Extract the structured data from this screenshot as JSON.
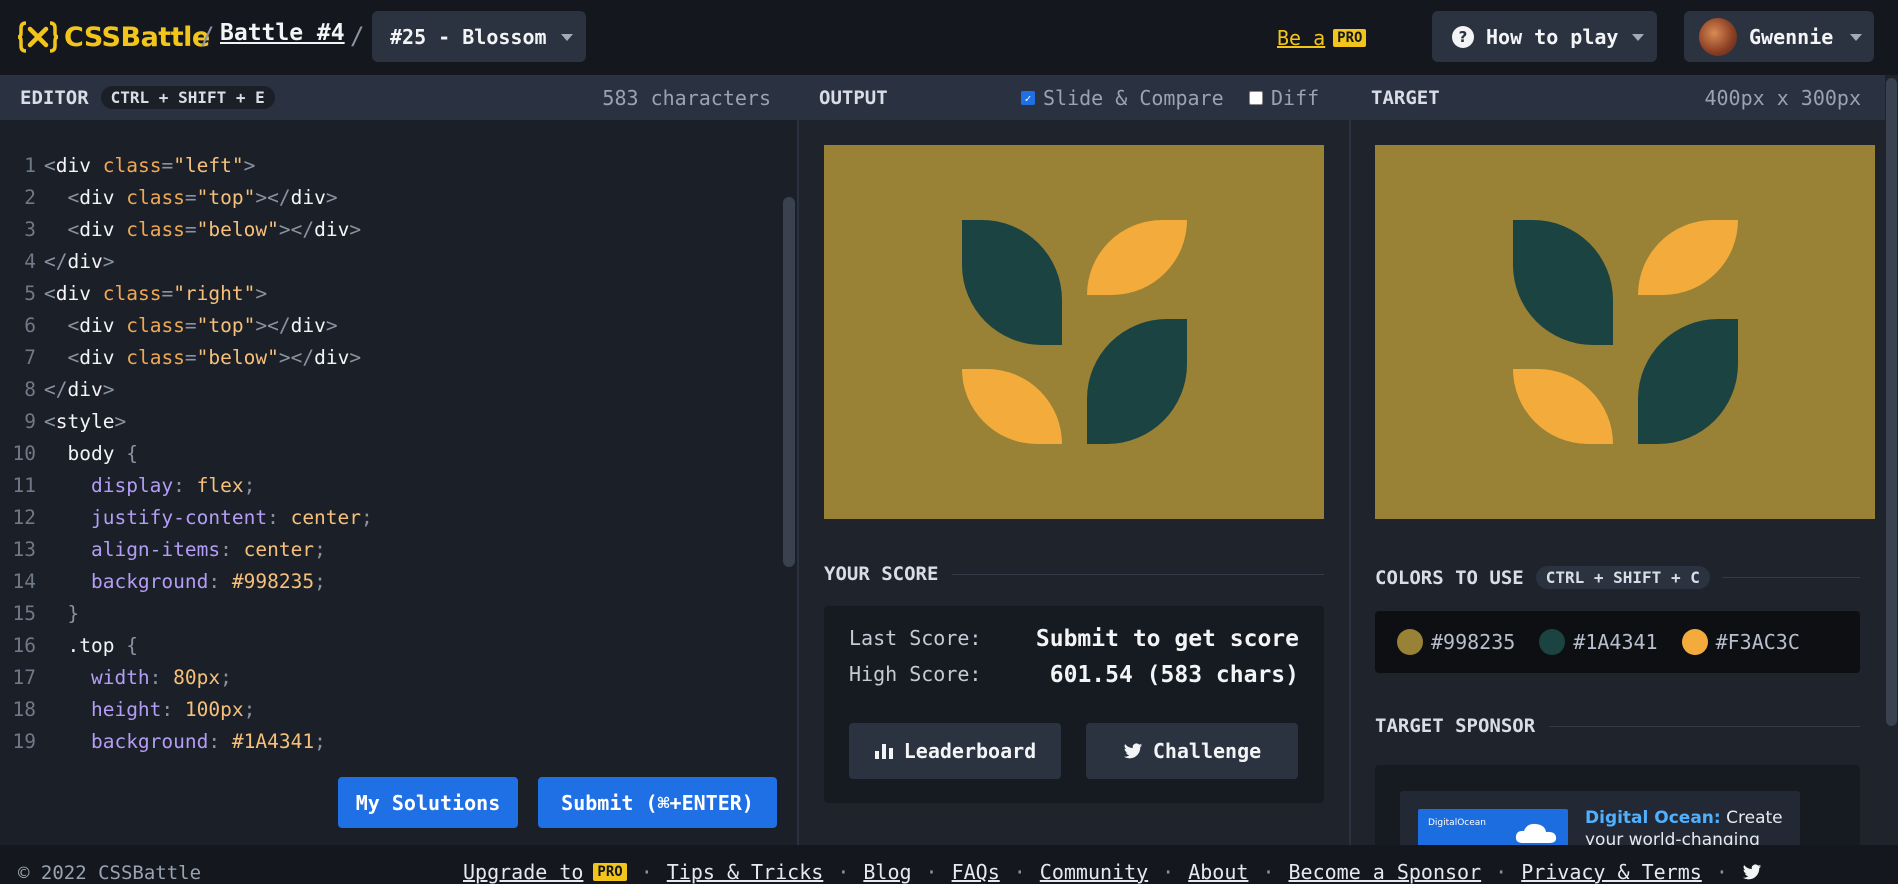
{
  "header": {
    "logo_text": "CSSBattle",
    "crumb_sep": "/",
    "battle_link": "Battle #4",
    "level_select": "#25 - Blossom",
    "be_a": "Be a",
    "pro_badge": "PRO",
    "how_to_play": "How to play",
    "user_name": "Gwennie"
  },
  "editor": {
    "title": "EDITOR",
    "shortcut": "CTRL + SHIFT + E",
    "char_count": "583 characters",
    "my_solutions": "My Solutions",
    "submit": "Submit (⌘+ENTER)"
  },
  "output": {
    "title": "OUTPUT",
    "slide_compare_label": "Slide & Compare",
    "slide_compare_checked": true,
    "diff_label": "Diff",
    "diff_checked": false,
    "score_title": "YOUR SCORE",
    "last_score_label": "Last Score:",
    "last_score_value": "Submit to get score",
    "high_score_label": "High Score:",
    "high_score_value": "601.54 (583 chars)",
    "leaderboard_button": "Leaderboard",
    "challenge_button": "Challenge"
  },
  "target": {
    "title": "TARGET",
    "dimensions": "400px x 300px",
    "colors_title": "COLORS TO USE",
    "colors_shortcut": "CTRL + SHIFT + C",
    "colors": [
      "#998235",
      "#1A4341",
      "#F3AC3C"
    ],
    "sponsor_title": "TARGET SPONSOR",
    "sponsor_image_text": "DigitalOcean",
    "sponsor_brand": "Digital Ocean:",
    "sponsor_text": "Create your world-changing"
  },
  "palette": {
    "background": "#998235",
    "dark_leaf": "#1A4341",
    "light_leaf": "#F3AC3C",
    "accent_yellow": "#f3c51b",
    "button_blue": "#1f6fe5"
  },
  "footer": {
    "copyright": "© 2022 CSSBattle",
    "links": [
      "Upgrade to",
      "Tips & Tricks",
      "Blog",
      "FAQs",
      "Community",
      "About",
      "Become a Sponsor",
      "Privacy & Terms"
    ],
    "pro_badge": "PRO",
    "separator": "·"
  }
}
